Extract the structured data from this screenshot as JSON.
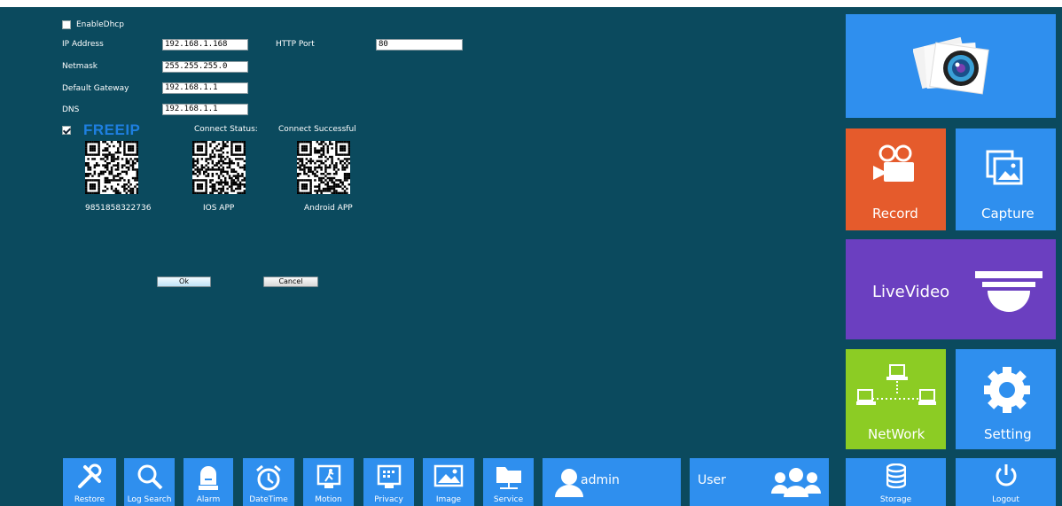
{
  "form": {
    "enable_dhcp_label": "EnableDhcp",
    "enable_dhcp_checked": false,
    "ip_label": "IP Address",
    "ip_value": "192.168.1.168",
    "http_port_label": "HTTP Port",
    "http_port_value": "80",
    "netmask_label": "Netmask",
    "netmask_value": "255.255.255.0",
    "gateway_label": "Default Gateway",
    "gateway_value": "192.168.1.1",
    "dns_label": "DNS",
    "dns_value": "192.168.1.1"
  },
  "freeip": {
    "checked": true,
    "logo_text": "FREEIP",
    "connect_status_label": "Connect Status:",
    "connect_status_value": "Connect  Successful",
    "qr_labels": [
      "9851858322736",
      "IOS APP",
      "Android APP"
    ]
  },
  "buttons": {
    "ok": "Ok",
    "cancel": "Cancel"
  },
  "tiles": {
    "record": "Record",
    "capture": "Capture",
    "livevideo": "LiveVideo",
    "network": "NetWork",
    "setting": "Setting",
    "storage": "Storage",
    "logout": "Logout"
  },
  "bottom": {
    "restore": "Restore",
    "log_search": "Log Search",
    "alarm": "Alarm",
    "datetime": "DateTime",
    "motion": "Motion",
    "privacy": "Privacy",
    "image": "Image",
    "service": "Service",
    "admin": "admin",
    "user": "User"
  },
  "colors": {
    "background": "#0b4a5e",
    "tile_blue": "#2f8fee",
    "tile_orange": "#e55b2c",
    "tile_purple": "#6b3fc0",
    "tile_green": "#8ccc24",
    "freeip_logo": "#1e7fe0"
  },
  "icons": [
    "photos-icon",
    "video-camera-icon",
    "capture-icon",
    "dome-camera-icon",
    "network-icon",
    "gear-icon",
    "database-icon",
    "power-icon",
    "tools-icon",
    "search-icon",
    "alarm-light-icon",
    "alarm-clock-icon",
    "motion-icon",
    "privacy-icon",
    "image-icon",
    "folder-network-icon",
    "user-icon",
    "users-icon"
  ]
}
